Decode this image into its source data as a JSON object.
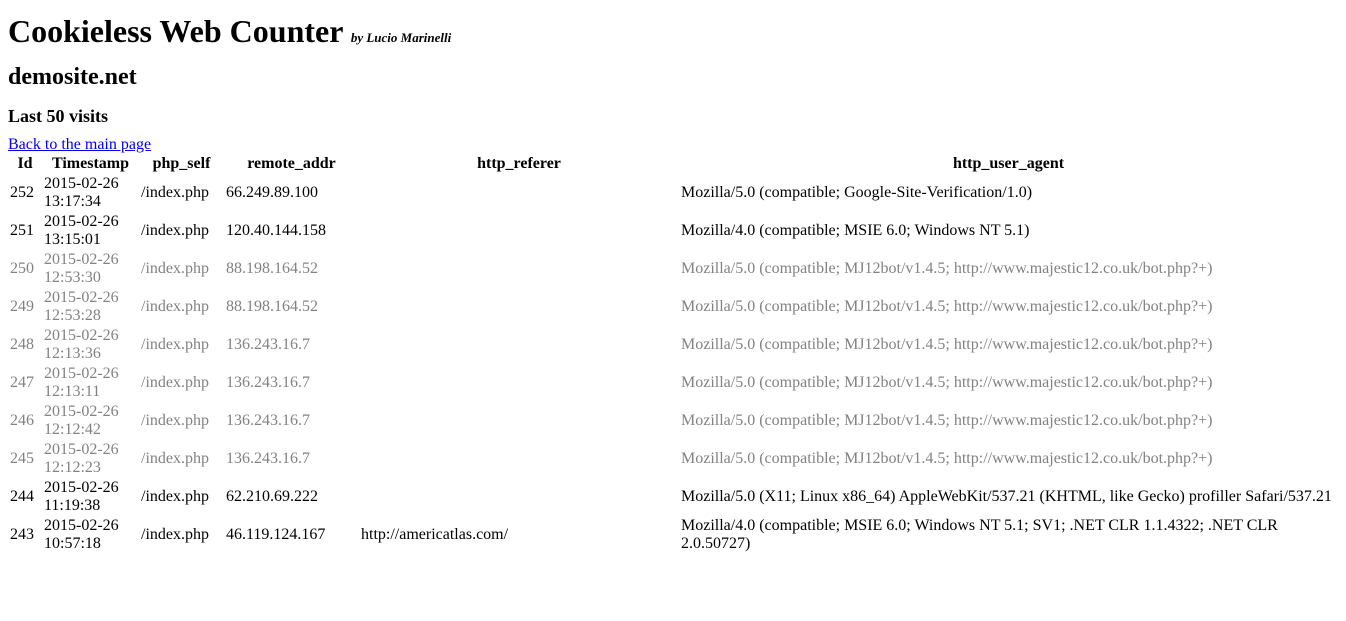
{
  "header": {
    "title": "Cookieless Web Counter",
    "byline": "by Lucio Marinelli"
  },
  "site": "demosite.net",
  "section": "Last 50 visits",
  "back_link": "Back to the main page",
  "columns": [
    "Id",
    "Timestamp",
    "php_self",
    "remote_addr",
    "http_referer",
    "http_user_agent"
  ],
  "rows": [
    {
      "faded": false,
      "id": "252",
      "ts": "2015-02-26 13:17:34",
      "self": "/index.php",
      "addr": "66.249.89.100",
      "ref": "",
      "ua": "Mozilla/5.0 (compatible; Google-Site-Verification/1.0)"
    },
    {
      "faded": false,
      "id": "251",
      "ts": "2015-02-26 13:15:01",
      "self": "/index.php",
      "addr": "120.40.144.158",
      "ref": "",
      "ua": "Mozilla/4.0 (compatible; MSIE 6.0; Windows NT 5.1)"
    },
    {
      "faded": true,
      "id": "250",
      "ts": "2015-02-26 12:53:30",
      "self": "/index.php",
      "addr": "88.198.164.52",
      "ref": "",
      "ua": "Mozilla/5.0 (compatible; MJ12bot/v1.4.5; http://www.majestic12.co.uk/bot.php?+)"
    },
    {
      "faded": true,
      "id": "249",
      "ts": "2015-02-26 12:53:28",
      "self": "/index.php",
      "addr": "88.198.164.52",
      "ref": "",
      "ua": "Mozilla/5.0 (compatible; MJ12bot/v1.4.5; http://www.majestic12.co.uk/bot.php?+)"
    },
    {
      "faded": true,
      "id": "248",
      "ts": "2015-02-26 12:13:36",
      "self": "/index.php",
      "addr": "136.243.16.7",
      "ref": "",
      "ua": "Mozilla/5.0 (compatible; MJ12bot/v1.4.5; http://www.majestic12.co.uk/bot.php?+)"
    },
    {
      "faded": true,
      "id": "247",
      "ts": "2015-02-26 12:13:11",
      "self": "/index.php",
      "addr": "136.243.16.7",
      "ref": "",
      "ua": "Mozilla/5.0 (compatible; MJ12bot/v1.4.5; http://www.majestic12.co.uk/bot.php?+)"
    },
    {
      "faded": true,
      "id": "246",
      "ts": "2015-02-26 12:12:42",
      "self": "/index.php",
      "addr": "136.243.16.7",
      "ref": "",
      "ua": "Mozilla/5.0 (compatible; MJ12bot/v1.4.5; http://www.majestic12.co.uk/bot.php?+)"
    },
    {
      "faded": true,
      "id": "245",
      "ts": "2015-02-26 12:12:23",
      "self": "/index.php",
      "addr": "136.243.16.7",
      "ref": "",
      "ua": "Mozilla/5.0 (compatible; MJ12bot/v1.4.5; http://www.majestic12.co.uk/bot.php?+)"
    },
    {
      "faded": false,
      "id": "244",
      "ts": "2015-02-26 11:19:38",
      "self": "/index.php",
      "addr": "62.210.69.222",
      "ref": "",
      "ua": "Mozilla/5.0 (X11; Linux x86_64) AppleWebKit/537.21 (KHTML, like Gecko) profiller Safari/537.21"
    },
    {
      "faded": false,
      "id": "243",
      "ts": "2015-02-26 10:57:18",
      "self": "/index.php",
      "addr": "46.119.124.167",
      "ref": "http://americatlas.com/",
      "ua": "Mozilla/4.0 (compatible; MSIE 6.0; Windows NT 5.1; SV1; .NET CLR 1.1.4322; .NET CLR 2.0.50727)"
    }
  ]
}
